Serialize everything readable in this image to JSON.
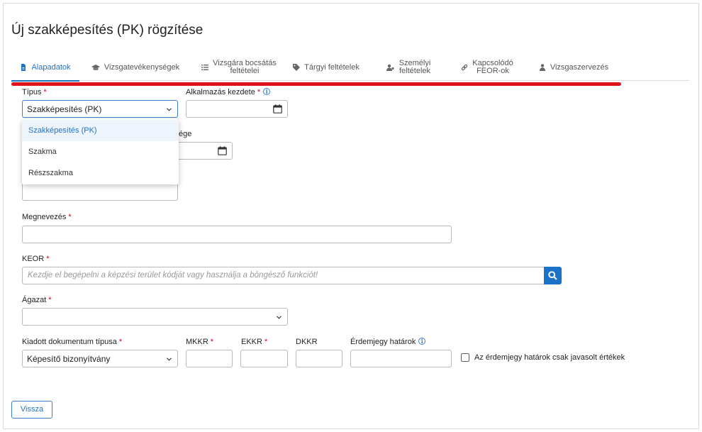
{
  "page": {
    "title": "Új szakképesítés (PK) rögzítése"
  },
  "tabs": [
    {
      "label": "Alapadatok",
      "icon": "document-icon",
      "active": true
    },
    {
      "label": "Vizsgatevékenységek",
      "icon": "graduation-cap-icon",
      "active": false
    },
    {
      "label": "Vizsgára bocsátás\nfeltételei",
      "icon": "list-icon",
      "active": false
    },
    {
      "label": "Tárgyi feltételek",
      "icon": "tag-icon",
      "active": false
    },
    {
      "label": "Személyi\nfeltételek",
      "icon": "users-icon",
      "active": false
    },
    {
      "label": "Kapcsolódó\nFEOR-ok",
      "icon": "link-icon",
      "active": false
    },
    {
      "label": "Vizsgaszervezés",
      "icon": "person-icon",
      "active": false
    }
  ],
  "form": {
    "tipus": {
      "label": "Típus",
      "value": "Szakképesítés (PK)"
    },
    "alkalmazas_kezdete": {
      "label": "Alkalmazás kezdete",
      "value": ""
    },
    "hidden_label_tail": {
      "label": "ége"
    },
    "megnevezes": {
      "label": "Megnevezés",
      "value": ""
    },
    "keor": {
      "label": "KEOR",
      "placeholder": "Kezdje el begépelni a képzési terület kódját vagy használja a böngésző funkciót!"
    },
    "agazat": {
      "label": "Ágazat",
      "value": ""
    },
    "kiadott_dokumentum": {
      "label": "Kiadott dokumentum típusa",
      "value": "Képesítő bizonyítvány"
    },
    "mkkr": {
      "label": "MKKR",
      "value": ""
    },
    "ekkr": {
      "label": "EKKR",
      "value": ""
    },
    "dkkr": {
      "label": "DKKR",
      "value": ""
    },
    "erdemjegy": {
      "label": "Érdemjegy határok",
      "value": ""
    },
    "checkbox_label": "Az érdemjegy határok csak javasolt értékek",
    "required_mark": "*"
  },
  "dropdown": {
    "options": [
      "Szakképesítés (PK)",
      "Szakma",
      "Részszakma"
    ],
    "selected_index": 0
  },
  "footer": {
    "back_label": "Vissza"
  },
  "colors": {
    "accent": "#1a73c8",
    "required": "#d6001c",
    "highlight_line": "#e0121a"
  }
}
